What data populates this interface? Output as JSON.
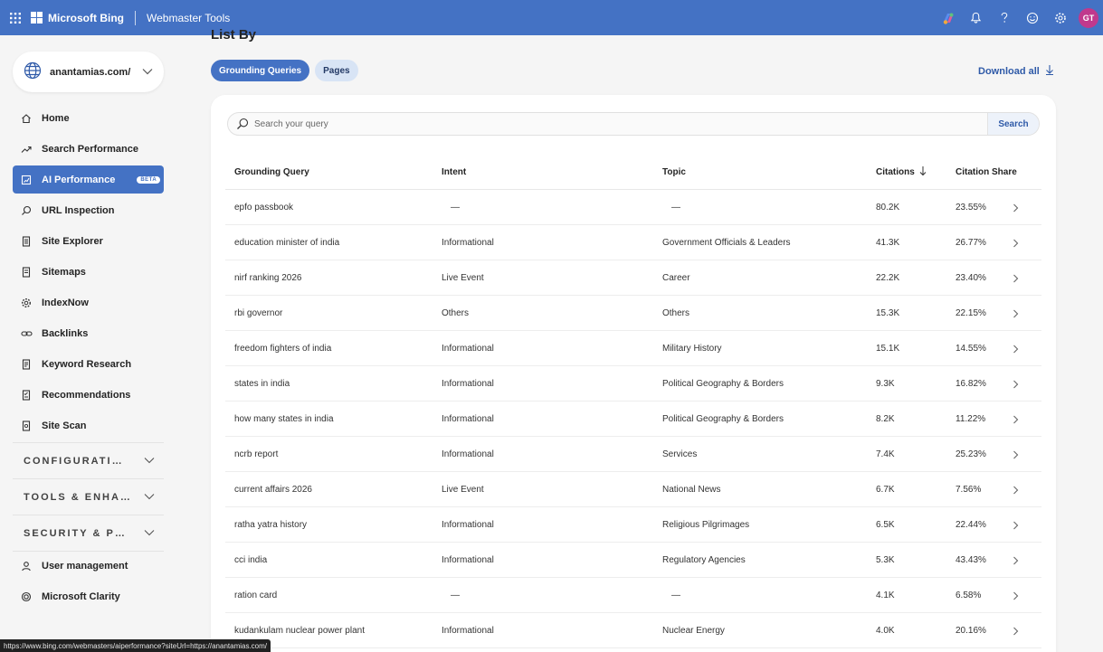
{
  "topbar": {
    "brand": "Microsoft Bing",
    "product": "Webmaster Tools",
    "avatar_initials": "GT",
    "icons": [
      "waffle-icon",
      "copilot-icon",
      "bell-icon",
      "help-icon",
      "feedback-smiley-icon",
      "gear-icon"
    ]
  },
  "site": {
    "name": "anantamias.com/"
  },
  "sidebar": {
    "items": [
      {
        "label": "Home",
        "icon": "home-icon"
      },
      {
        "label": "Search Performance",
        "icon": "trend-icon"
      },
      {
        "label": "AI Performance",
        "icon": "ai-icon",
        "badge": "BETA",
        "active": true
      },
      {
        "label": "URL Inspection",
        "icon": "search-icon"
      },
      {
        "label": "Site Explorer",
        "icon": "document-icon"
      },
      {
        "label": "Sitemaps",
        "icon": "sitemap-icon"
      },
      {
        "label": "IndexNow",
        "icon": "gear-icon"
      },
      {
        "label": "Backlinks",
        "icon": "link-icon"
      },
      {
        "label": "Keyword Research",
        "icon": "document-icon"
      },
      {
        "label": "Recommendations",
        "icon": "checklist-icon"
      },
      {
        "label": "Site Scan",
        "icon": "scan-icon"
      }
    ],
    "sections": [
      "CONFIGURATION",
      "TOOLS & ENHANCEMENTS",
      "SECURITY & PRIVACY"
    ],
    "bottom_items": [
      {
        "label": "User management",
        "icon": "person-icon"
      },
      {
        "label": "Microsoft Clarity",
        "icon": "clarity-icon"
      }
    ]
  },
  "main": {
    "list_by": "List By",
    "tabs": [
      {
        "label": "Grounding Queries",
        "active": true
      },
      {
        "label": "Pages",
        "active": false
      }
    ],
    "download_label": "Download all",
    "search": {
      "placeholder": "Search your query",
      "button": "Search"
    },
    "columns": [
      "Grounding Query",
      "Intent",
      "Topic",
      "Citations",
      "Citation Share"
    ],
    "rows": [
      {
        "query": "epfo passbook",
        "intent": "—",
        "topic": "—",
        "citations": "80.2K",
        "share": "23.55%"
      },
      {
        "query": "education minister of india",
        "intent": "Informational",
        "topic": "Government Officials & Leaders",
        "citations": "41.3K",
        "share": "26.77%"
      },
      {
        "query": "nirf ranking 2026",
        "intent": "Live Event",
        "topic": "Career",
        "citations": "22.2K",
        "share": "23.40%"
      },
      {
        "query": "rbi governor",
        "intent": "Others",
        "topic": "Others",
        "citations": "15.3K",
        "share": "22.15%"
      },
      {
        "query": "freedom fighters of india",
        "intent": "Informational",
        "topic": "Military History",
        "citations": "15.1K",
        "share": "14.55%"
      },
      {
        "query": "states in india",
        "intent": "Informational",
        "topic": "Political Geography & Borders",
        "citations": "9.3K",
        "share": "16.82%"
      },
      {
        "query": "how many states in india",
        "intent": "Informational",
        "topic": "Political Geography & Borders",
        "citations": "8.2K",
        "share": "11.22%"
      },
      {
        "query": "ncrb report",
        "intent": "Informational",
        "topic": "Services",
        "citations": "7.4K",
        "share": "25.23%"
      },
      {
        "query": "current affairs 2026",
        "intent": "Live Event",
        "topic": "National News",
        "citations": "6.7K",
        "share": "7.56%"
      },
      {
        "query": "ratha yatra history",
        "intent": "Informational",
        "topic": "Religious Pilgrimages",
        "citations": "6.5K",
        "share": "22.44%"
      },
      {
        "query": "cci india",
        "intent": "Informational",
        "topic": "Regulatory Agencies",
        "citations": "5.3K",
        "share": "43.43%"
      },
      {
        "query": "ration card",
        "intent": "—",
        "topic": "—",
        "citations": "4.1K",
        "share": "6.58%"
      },
      {
        "query": "kudankulam nuclear power plant",
        "intent": "Informational",
        "topic": "Nuclear Energy",
        "citations": "4.0K",
        "share": "20.16%"
      }
    ]
  },
  "status_url": "https://www.bing.com/webmasters/aiperformance?siteUrl=https://anantamias.com/",
  "colors": {
    "header": "#4472c4",
    "accent": "#4472c4",
    "avatar": "#c0398d"
  }
}
